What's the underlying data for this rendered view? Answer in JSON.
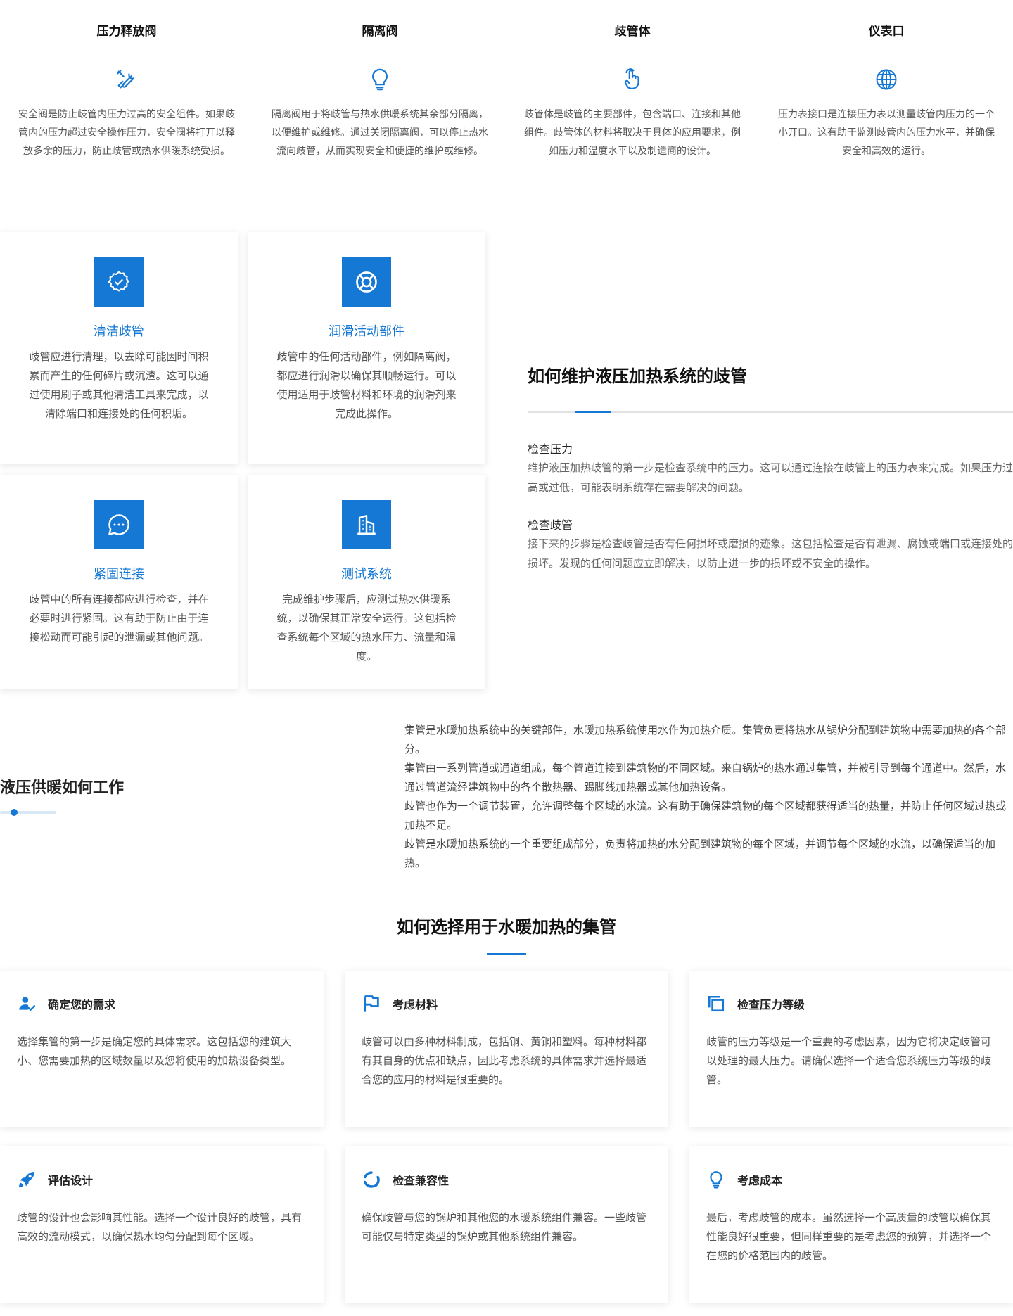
{
  "components": {
    "items": [
      {
        "title": "压力释放阀",
        "icon": "tools-icon",
        "desc": "安全阀是防止歧管内压力过高的安全组件。如果歧管内的压力超过安全操作压力，安全阀将打开以释放多余的压力，防止歧管或热水供暖系统受损。"
      },
      {
        "title": "隔离阀",
        "icon": "lightbulb-icon",
        "desc": "隔离阀用于将歧管与热水供暖系统其余部分隔离，以便维护或维修。通过关闭隔离阀，可以停止热水流向歧管，从而实现安全和便捷的维护或维修。"
      },
      {
        "title": "歧管体",
        "icon": "pointer-hand-icon",
        "desc": "歧管体是歧管的主要部件，包含端口、连接和其他组件。歧管体的材料将取决于具体的应用要求，例如压力和温度水平以及制造商的设计。"
      },
      {
        "title": "仪表口",
        "icon": "globe-icon",
        "desc": "压力表接口是连接压力表以测量歧管内压力的一个小开口。这有助于监测歧管内的压力水平，并确保安全和高效的运行。"
      }
    ]
  },
  "maintenance": {
    "cards": [
      {
        "title": "清洁歧管",
        "icon": "gear-check-icon",
        "desc": "歧管应进行清理，以去除可能因时间积累而产生的任何碎片或沉渣。这可以通过使用刷子或其他清洁工具来完成，以清除端口和连接处的任何积垢。"
      },
      {
        "title": "润滑活动部件",
        "icon": "lifebuoy-icon",
        "desc": "歧管中的任何活动部件，例如隔离阀，都应进行润滑以确保其顺畅运行。可以使用适用于歧管材料和环境的润滑剂来完成此操作。"
      },
      {
        "title": "紧固连接",
        "icon": "chat-bubble-icon",
        "desc": "歧管中的所有连接都应进行检查，并在必要时进行紧固。这有助于防止由于连接松动而可能引起的泄漏或其他问题。"
      },
      {
        "title": "测试系统",
        "icon": "building-icon",
        "desc": "完成维护步骤后，应测试热水供暖系统，以确保其正常安全运行。这包括检查系统每个区域的热水压力、流量和温度。"
      }
    ],
    "heading": "如何维护液压加热系统的歧管",
    "steps": [
      {
        "title": "检查压力",
        "desc": "维护液压加热歧管的第一步是检查系统中的压力。这可以通过连接在歧管上的压力表来完成。如果压力过高或过低，可能表明系统存在需要解决的问题。"
      },
      {
        "title": "检查歧管",
        "desc": "接下来的步骤是检查歧管是否有任何损坏或磨损的迹象。这包括检查是否有泄漏、腐蚀或端口或连接处的损坏。发现的任何问题应立即解决，以防止进一步的损坏或不安全的操作。"
      }
    ]
  },
  "howItWorks": {
    "heading": "液压供暖如何工作",
    "paragraphs": [
      "集管是水暖加热系统中的关键部件，水暖加热系统使用水作为加热介质。集管负责将热水从锅炉分配到建筑物中需要加热的各个部分。",
      "集管由一系列管道或通道组成，每个管道连接到建筑物的不同区域。来自锅炉的热水通过集管，并被引导到每个通道中。然后，水通过管道流经建筑物中的各个散热器、踢脚线加热器或其他加热设备。",
      "歧管也作为一个调节装置，允许调整每个区域的水流。这有助于确保建筑物的每个区域都获得适当的热量，并防止任何区域过热或加热不足。",
      "歧管是水暖加热系统的一个重要组成部分，负责将加热的水分配到建筑物的每个区域，并调节每个区域的水流，以确保适当的加热。"
    ]
  },
  "choose": {
    "heading": "如何选择用于水暖加热的集管",
    "cards": [
      {
        "title": "确定您的需求",
        "icon": "user-check-icon",
        "desc": "选择集管的第一步是确定您的具体需求。这包括您的建筑大小、您需要加热的区域数量以及您将使用的加热设备类型。"
      },
      {
        "title": "考虑材料",
        "icon": "flag-icon",
        "desc": "歧管可以由多种材料制成，包括铜、黄铜和塑料。每种材料都有其自身的优点和缺点，因此考虑系统的具体需求并选择最适合您的应用的材料是很重要的。"
      },
      {
        "title": "检查压力等级",
        "icon": "copy-squares-icon",
        "desc": "歧管的压力等级是一个重要的考虑因素，因为它将决定歧管可以处理的最大压力。请确保选择一个适合您系统压力等级的歧管。"
      },
      {
        "title": "评估设计",
        "icon": "rocket-icon",
        "desc": "歧管的设计也会影响其性能。选择一个设计良好的歧管，具有高效的流动模式，以确保热水均匀分配到每个区域。"
      },
      {
        "title": "检查兼容性",
        "icon": "circle-arrows-icon",
        "desc": "确保歧管与您的锅炉和其他您的水暖系统组件兼容。一些歧管可能仅与特定类型的锅炉或其他系统组件兼容。"
      },
      {
        "title": "考虑成本",
        "icon": "lightbulb-icon",
        "desc": "最后，考虑歧管的成本。虽然选择一个高质量的歧管以确保其性能良好很重要，但同样重要的是考虑您的预算，并选择一个在您的价格范围内的歧管。"
      }
    ]
  },
  "colors": {
    "accent": "#1478d4",
    "text": "#333333",
    "muted": "#666666"
  }
}
